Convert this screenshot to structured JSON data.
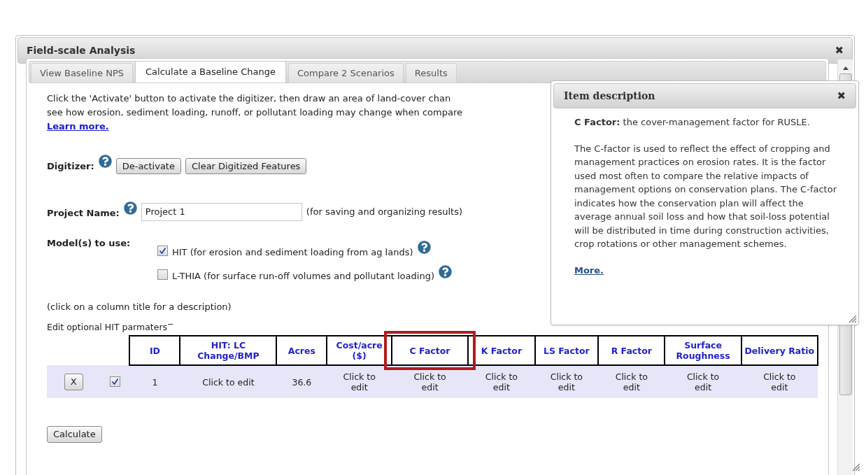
{
  "window": {
    "title": "Field-scale Analysis",
    "close": "✖"
  },
  "tabs": [
    {
      "label": "View Baseline NPS",
      "selected": false
    },
    {
      "label": "Calculate a Baseline Change",
      "selected": true
    },
    {
      "label": "Compare 2 Scenarios",
      "selected": false
    },
    {
      "label": "Results",
      "selected": false
    }
  ],
  "intro": {
    "lines": [
      "Click the 'Activate' button to activate the digitizer, then draw an area of land-cover chan",
      "see how erosion, sediment loading, runoff, or pollutant loading may change when compare"
    ],
    "link": "Learn more."
  },
  "digitizer": {
    "label": "Digitizer:",
    "buttons": [
      "De-activate",
      "Clear Digitized Features"
    ]
  },
  "project": {
    "label": "Project Name:",
    "value": "Project 1",
    "note": "(for saving and organizing results)"
  },
  "models": {
    "label": "Model(s) to use:",
    "items": [
      {
        "label": "HIT (for erosion and sediment loading from ag lands)",
        "checked": true
      },
      {
        "label": "L-THIA (for surface run-off volumes and pollutant loading)",
        "checked": false
      }
    ]
  },
  "table_hint": "(click on a column title for a description)",
  "params": {
    "label": "Edit optional HIT parmaters",
    "toggle": "−"
  },
  "table": {
    "columns": [
      {
        "label": "ID",
        "highlighted": false
      },
      {
        "label": "HIT: LC Change/BMP",
        "highlighted": false
      },
      {
        "label": "Acres",
        "highlighted": false
      },
      {
        "label": "Cost/acre ($)",
        "highlighted": false
      },
      {
        "label": "C Factor",
        "highlighted": true
      },
      {
        "label": "K Factor",
        "highlighted": false
      },
      {
        "label": "LS Factor",
        "highlighted": false
      },
      {
        "label": "R Factor",
        "highlighted": false
      },
      {
        "label": "Surface Roughness",
        "highlighted": false
      },
      {
        "label": "Delivery Ratio",
        "highlighted": false
      }
    ],
    "rows": [
      {
        "remove": "X",
        "checked": true,
        "cells": [
          "1",
          "Click to edit",
          "36.6",
          "Click to edit",
          "Click to edit",
          "Click to edit",
          "Click to edit",
          "Click to edit",
          "Click to edit",
          "Click to edit"
        ]
      }
    ]
  },
  "calculate": "Calculate",
  "popup": {
    "title": "Item description",
    "close": "✖",
    "term": "C Factor:",
    "definition": "the cover-management factor for RUSLE.",
    "body": "The C-factor is used to reflect the effect of cropping and management practices on erosion rates. It is the factor used most often to compare the relative impacts of management options on conservation plans. The C-factor indicates how the conservation plan will affect the average annual soil loss and how that soil-loss potential will be distributed in time during construction activities, crop rotations or other management schemes.",
    "link": "More."
  }
}
